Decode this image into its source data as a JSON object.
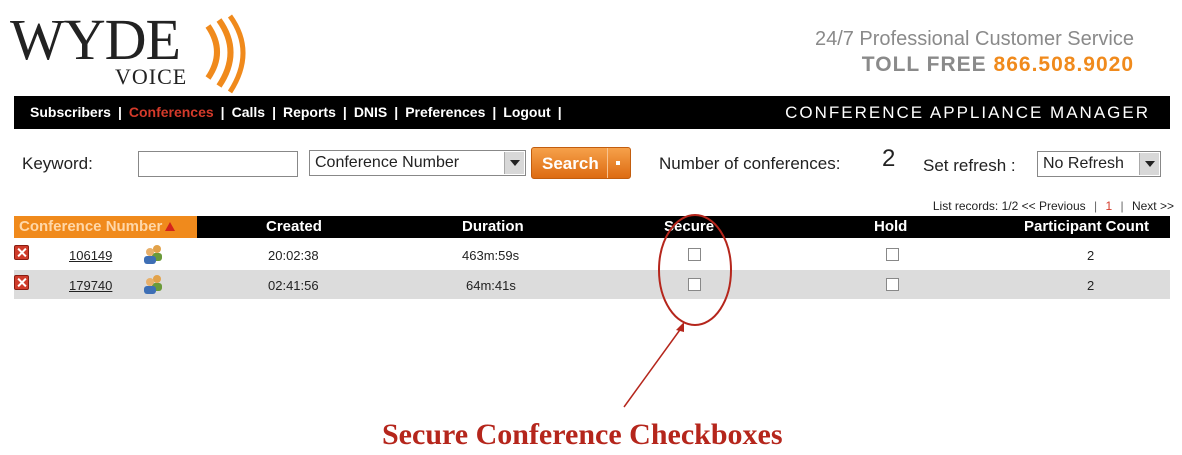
{
  "brand": {
    "logo_main": "WYDE",
    "logo_sub": "VOICE",
    "tagline": "24/7 Professional Customer Service",
    "toll_free_label": "TOLL  FREE",
    "phone": "866.508.9020",
    "colors": {
      "accent": "#f08a1c",
      "active_nav": "#d43a2a"
    }
  },
  "nav": {
    "items": [
      {
        "label": "Subscribers",
        "active": false
      },
      {
        "label": "Conferences",
        "active": true
      },
      {
        "label": "Calls",
        "active": false
      },
      {
        "label": "Reports",
        "active": false
      },
      {
        "label": "DNIS",
        "active": false
      },
      {
        "label": "Preferences",
        "active": false
      },
      {
        "label": "Logout",
        "active": false
      }
    ],
    "separator": "|",
    "app_title": "CONFERENCE APPLIANCE MANAGER"
  },
  "search": {
    "keyword_label": "Keyword:",
    "keyword_value": "",
    "field_select": "Conference Number",
    "button_label": "Search",
    "count_label": "Number of conferences:",
    "count_value": "2",
    "refresh_label": "Set refresh :",
    "refresh_select": "No Refresh"
  },
  "pager": {
    "label": "List records:",
    "range": "1/2",
    "prev": "<< Previous",
    "page": "1",
    "next": "Next >>"
  },
  "table": {
    "columns": [
      "Conference Number",
      "Created",
      "Duration",
      "Secure",
      "Hold",
      "Participant Count"
    ],
    "rows": [
      {
        "number": "106149",
        "created": "20:02:38",
        "duration": "463m:59s",
        "secure": false,
        "hold": false,
        "participants": "2"
      },
      {
        "number": "179740",
        "created": "02:41:56",
        "duration": "64m:41s",
        "secure": false,
        "hold": false,
        "participants": "2"
      }
    ]
  },
  "annotation": {
    "caption": "Secure Conference Checkboxes",
    "color": "#b5261c"
  }
}
